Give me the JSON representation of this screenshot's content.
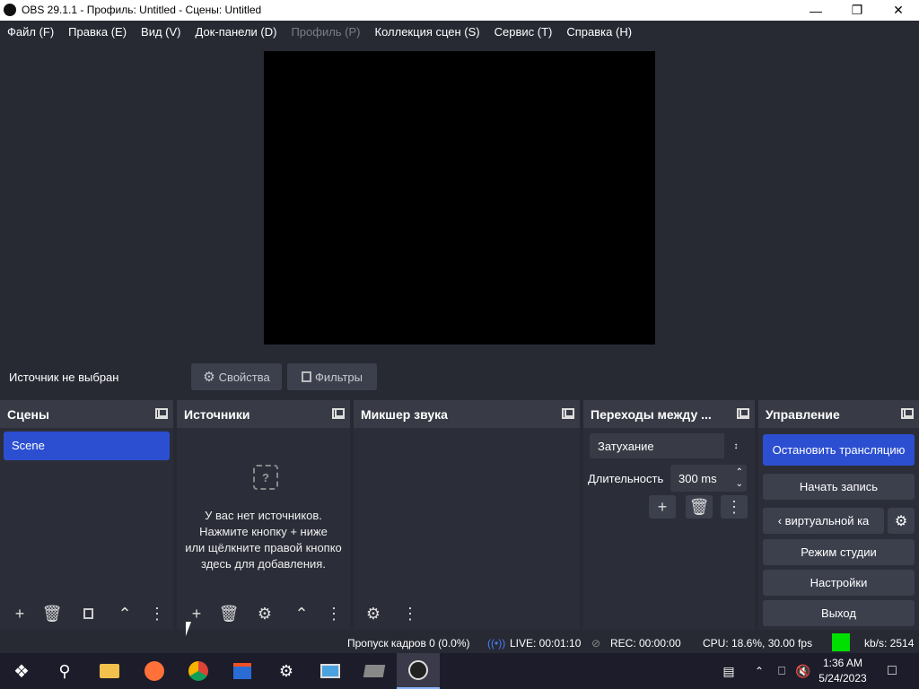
{
  "window": {
    "title": "OBS 29.1.1 - Профиль: Untitled - Сцены: Untitled"
  },
  "menu": [
    "Файл (F)",
    "Правка (E)",
    "Вид (V)",
    "Док-панели (D)",
    "Профиль (P)",
    "Коллекция сцен (S)",
    "Сервис (T)",
    "Справка (H)"
  ],
  "source_bar": {
    "no_source": "Источник не выбран",
    "properties": "Свойства",
    "filters": "Фильтры"
  },
  "docks": {
    "scenes": {
      "title": "Сцены",
      "items": [
        "Scene"
      ]
    },
    "sources": {
      "title": "Источники",
      "empty_line1": "У вас нет источников.",
      "empty_line2": "Нажмите кнопку + ниже",
      "empty_line3": "или щёлкните правой кнопко",
      "empty_line4": "здесь для добавления."
    },
    "mixer": {
      "title": "Микшер звука"
    },
    "transitions": {
      "title": "Переходы между ...",
      "type": "Затухание",
      "duration_label": "Длительность",
      "duration_value": "300 ms"
    },
    "controls": {
      "title": "Управление",
      "stop_stream": "Остановить трансляцию",
      "start_record": "Начать запись",
      "virtual_cam": "‹ виртуальной ка",
      "studio_mode": "Режим студии",
      "settings": "Настройки",
      "exit": "Выход"
    }
  },
  "status": {
    "dropped": "Пропуск кадров 0 (0.0%)",
    "live": "LIVE: 00:01:10",
    "rec": "REC: 00:00:00",
    "cpu": "CPU: 18.6%, 30.00 fps",
    "kbs": "kb/s: 2514"
  },
  "taskbar": {
    "time": "1:36 AM",
    "date": "5/24/2023"
  },
  "colors": {
    "accent": "#2c4fd1",
    "bg": "#272a33",
    "dock": "#2b2e38",
    "live_indicator": "#00e000"
  }
}
